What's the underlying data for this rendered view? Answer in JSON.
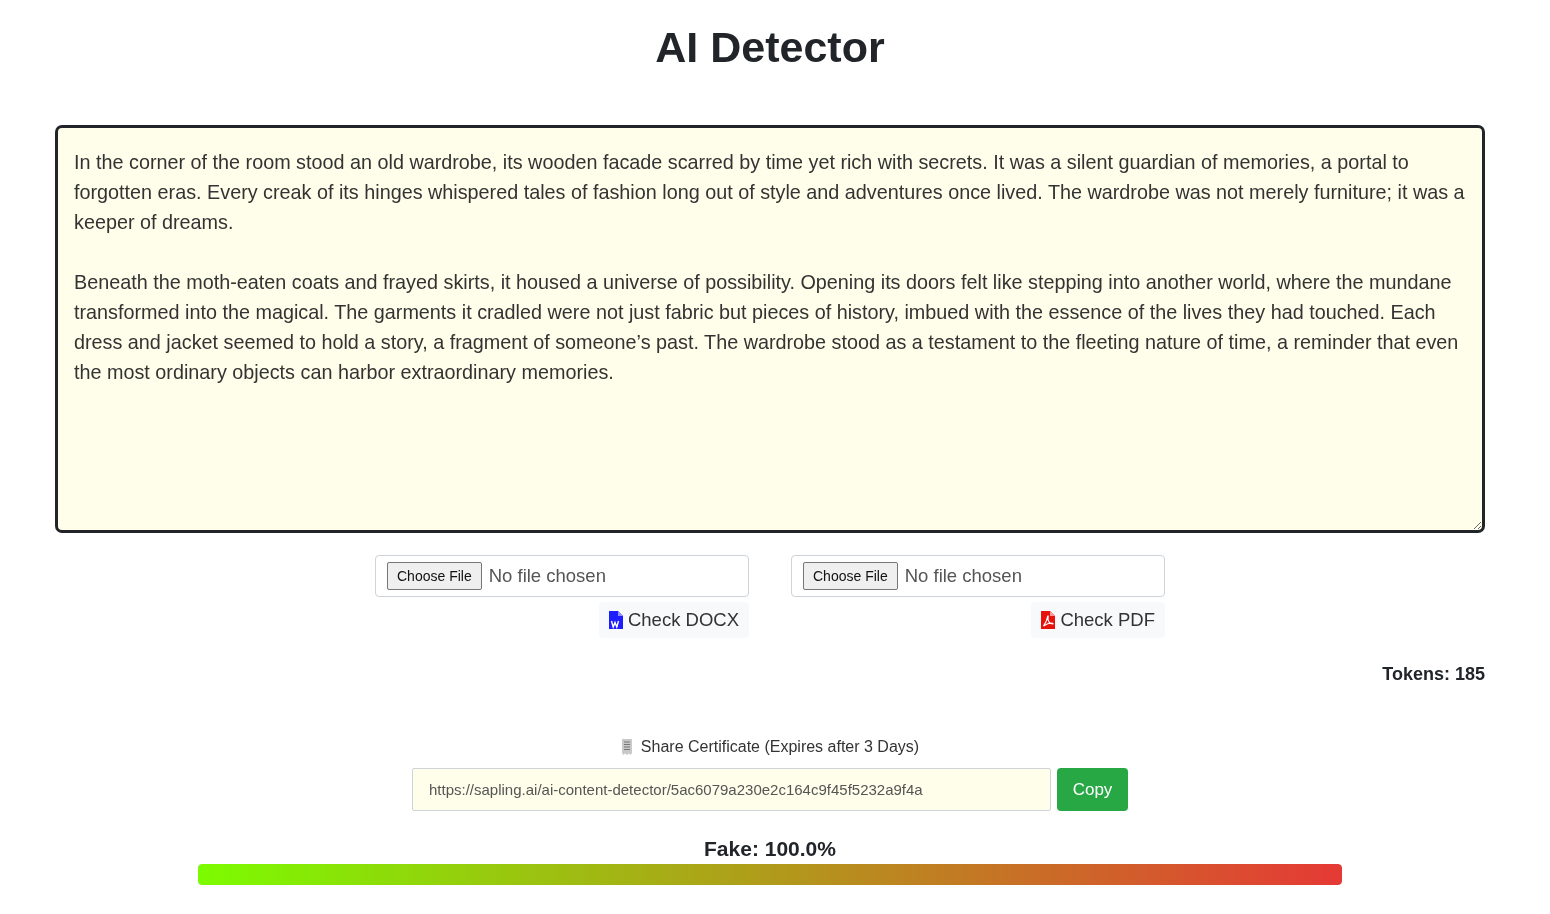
{
  "title": "AI Detector",
  "text_input": {
    "value": "In the corner of the room stood an old wardrobe, its wooden facade scarred by time yet rich with secrets. It was a silent guardian of memories, a portal to forgotten eras. Every creak of its hinges whispered tales of fashion long out of style and adventures once lived. The wardrobe was not merely furniture; it was a keeper of dreams.\n\nBeneath the moth-eaten coats and frayed skirts, it housed a universe of possibility. Opening its doors felt like stepping into another world, where the mundane transformed into the magical. The garments it cradled were not just fabric but pieces of history, imbued with the essence of the lives they had touched. Each dress and jacket seemed to hold a story, a fragment of someone’s past. The wardrobe stood as a testament to the fleeting nature of time, a reminder that even the most ordinary objects can harbor extraordinary memories."
  },
  "uploads": [
    {
      "kind": "docx",
      "choose_label": "Choose File",
      "file_status": "No file chosen",
      "check_label": "Check DOCX"
    },
    {
      "kind": "pdf",
      "choose_label": "Choose File",
      "file_status": "No file chosen",
      "check_label": "Check PDF"
    }
  ],
  "tokens": "Tokens: 185",
  "share": {
    "label": "Share Certificate (Expires after 3 Days)",
    "url": "https://sapling.ai/ai-content-detector/5ac6079a230e2c164c9f45f5232a9f4a",
    "button": "Copy"
  },
  "result": {
    "label": "Fake: 100.0%",
    "level": 1
  }
}
